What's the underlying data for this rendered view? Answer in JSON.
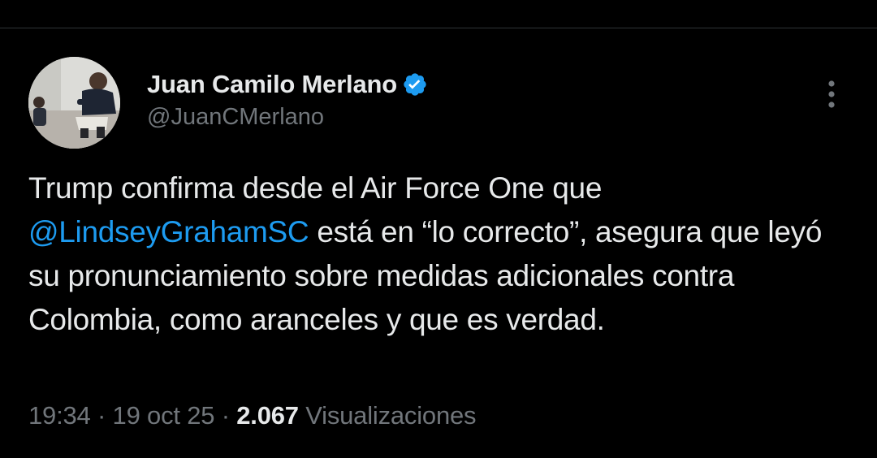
{
  "author": {
    "display_name": "Juan Camilo Merlano",
    "handle": "@JuanCMerlano",
    "verified": true,
    "verified_color": "#1d9bf0"
  },
  "menu": {
    "icon": "more-vertical-icon"
  },
  "tweet": {
    "text_part1": "Trump confirma desde el Air Force One que ",
    "mention": "@LindseyGrahamSC",
    "text_part2": " está en “lo correcto”, asegura que leyó su pronunciamiento sobre medidas adicionales contra Colombia, como aranceles y que es verdad."
  },
  "meta": {
    "time": "19:34",
    "separator": " · ",
    "date": "19 oct 25",
    "views_count": "2.067",
    "views_label": " Visualizaciones"
  },
  "colors": {
    "background": "#000000",
    "primary_text": "#e7e9ea",
    "secondary_text": "#71767b",
    "link": "#1d9bf0",
    "divider": "#2f3336"
  }
}
